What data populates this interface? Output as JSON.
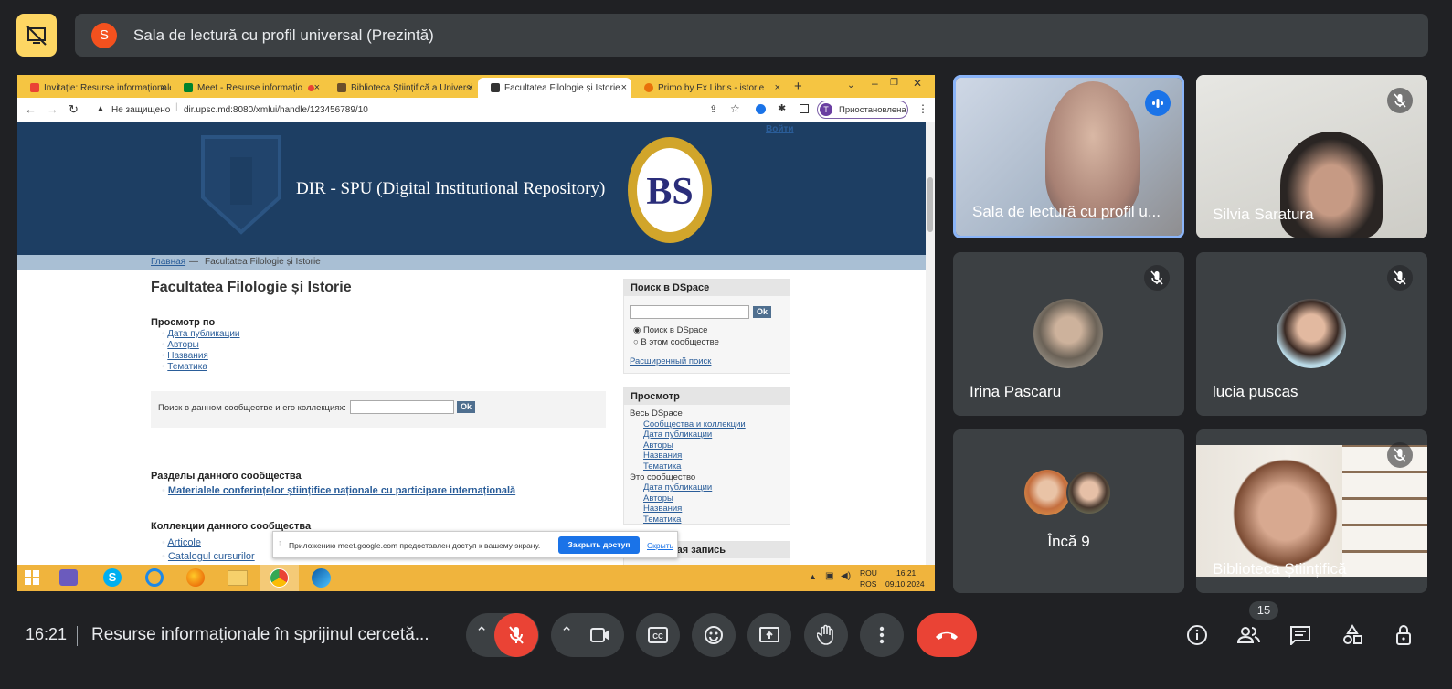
{
  "presenter": {
    "avatar_letter": "S",
    "title": "Sala de lectură cu profil universal (Prezintă)"
  },
  "browser": {
    "tabs": [
      {
        "label": "Invitație: Resurse informaționale",
        "close": "×",
        "favicon_color": "#ea4335"
      },
      {
        "label": "Meet - Resurse informațio",
        "close": "×",
        "favicon_color": "#00832d"
      },
      {
        "label": "Biblioteca Științifică a Universi",
        "close": "×",
        "favicon_color": "#6b4f2a"
      },
      {
        "label": "Facultatea Filologie și Istorie",
        "close": "×",
        "favicon_color": "#333333"
      },
      {
        "label": "Primo by Ex Libris - istorie",
        "close": "×",
        "favicon_color": "#e8710a"
      }
    ],
    "new_tab": "+",
    "security_label": "Не защищено",
    "url": "dir.upsc.md:8080/xmlui/handle/123456789/10",
    "profile_letter": "T",
    "paused_label": "Приостановлена"
  },
  "dspace": {
    "login": "Войти",
    "banner_title": "DIR - SPU (Digital Institutional Repository)",
    "breadcrumb_home": "Главная",
    "breadcrumb_sep": "—",
    "breadcrumb_current": "Facultatea Filologie și Istorie",
    "page_title": "Facultatea Filologie și Istorie",
    "browse_heading": "Просмотр по",
    "browse_links": [
      "Дата публикации",
      "Авторы",
      "Названия",
      "Тематика"
    ],
    "search_label": "Поиск в данном сообществе и его коллекциях:",
    "ok": "Ok",
    "subcommunities_heading": "Разделы данного сообщества",
    "subcommunities": [
      "Materialele conferințelor științifice naționale cu participare internațională"
    ],
    "collections_heading": "Коллекции данного сообщества",
    "collections": [
      "Articole",
      "Catalogul cursurilor"
    ],
    "side_search_heading": "Поиск в DSpace",
    "radio_dspace": "Поиск в DSpace",
    "radio_community": "В этом сообществе",
    "advanced_search": "Расширенный поиск",
    "side_browse_heading": "Просмотр",
    "all_dspace": "Весь DSpace",
    "all_links": [
      "Сообщества и коллекции",
      "Дата публикации",
      "Авторы",
      "Названия",
      "Тематика"
    ],
    "this_community": "Это сообщество",
    "community_links": [
      "Дата публикации",
      "Авторы",
      "Названия",
      "Тематика"
    ],
    "my_account_heading": "...ая запись"
  },
  "share_notice": {
    "text": "Приложению meet.google.com предоставлен доступ к вашему экрану.",
    "stop_button": "Закрыть доступ",
    "hide_link": "Скрыть"
  },
  "taskbar": {
    "lang_top": "ROU",
    "lang_bottom": "ROS",
    "time": "16:21",
    "date": "09.10.2024"
  },
  "participants": [
    {
      "name": "Sala de lectură cu profil u...",
      "speaking": true
    },
    {
      "name": "Silvia Saratura",
      "muted": true
    },
    {
      "name": "Irina Pascaru",
      "muted": true
    },
    {
      "name": "lucia puscas",
      "muted": true
    },
    {
      "name": "Încă 9"
    },
    {
      "name": "Biblioteca Științifică",
      "muted": true
    }
  ],
  "bottom_bar": {
    "time": "16:21",
    "meeting_title": "Resurse informaționale în sprijinul cercetă...",
    "people_count": "15"
  },
  "colors": {
    "end_call": "#ea4335",
    "mic_muted": "#ea4335",
    "accent": "#8ab4f8",
    "presenting": "#fdd663"
  }
}
